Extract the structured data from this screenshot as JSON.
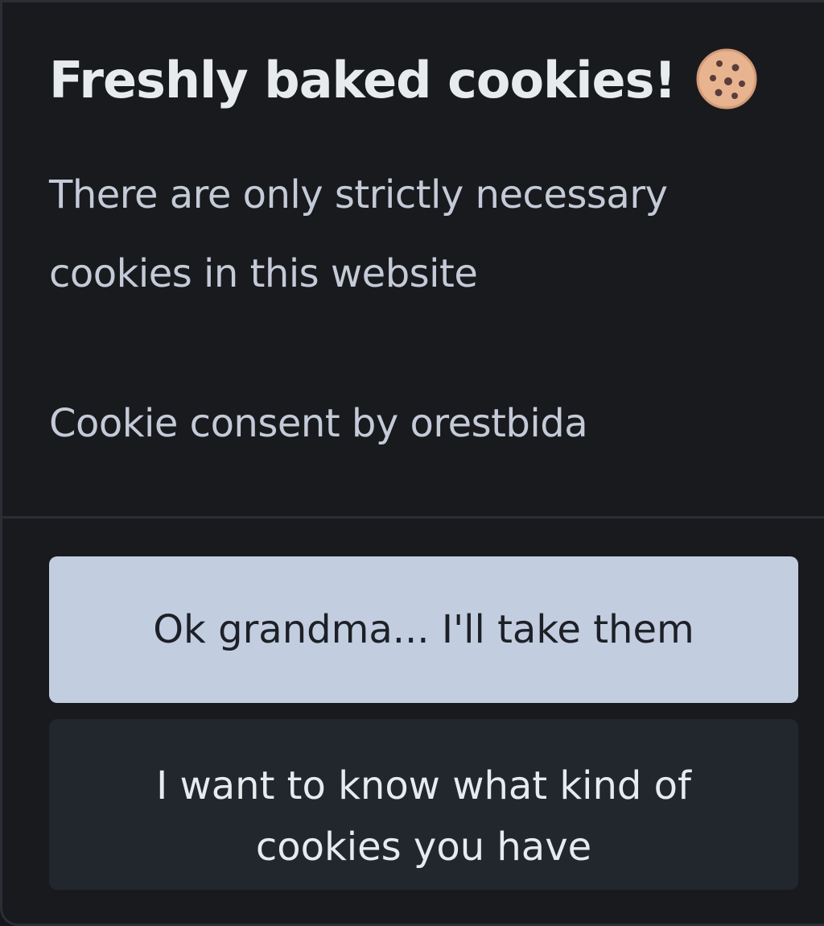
{
  "consent": {
    "title": "Freshly baked cookies!",
    "title_icon": "cookie-icon",
    "description_line1": "There are only strictly necessary",
    "description_line2": "cookies in this website",
    "credit": "Cookie consent by orestbida",
    "accept_label": "Ok grandma... I'll take them",
    "preferences_label": "I want to know what kind of cookies you have"
  },
  "colors": {
    "background": "#181a1e",
    "title": "#e8ebee",
    "text": "#c4cad7",
    "primary_button": "#c2cde0",
    "secondary_button": "#22272e"
  }
}
